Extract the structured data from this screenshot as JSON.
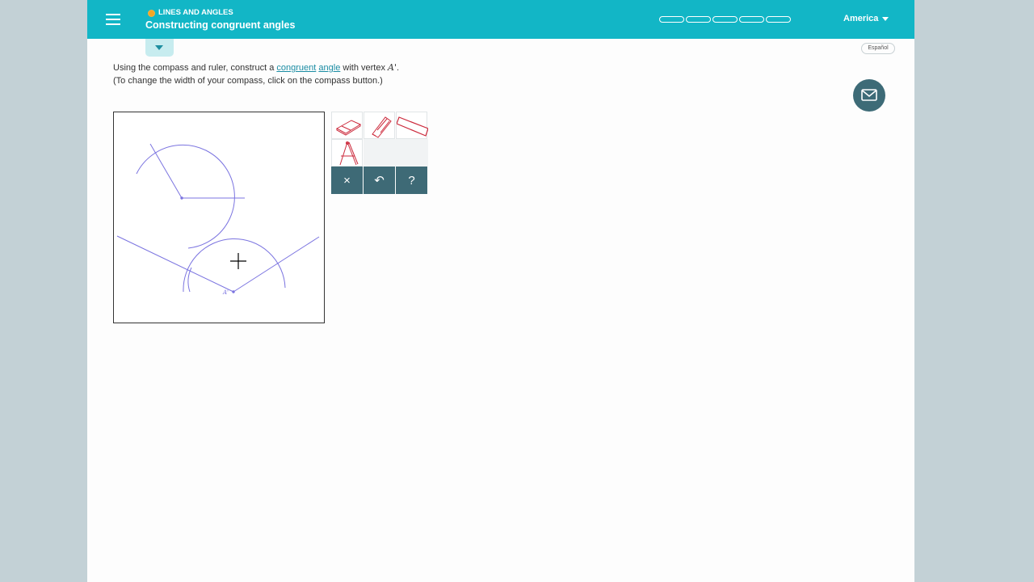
{
  "header": {
    "topic_label": "LINES AND ANGLES",
    "title": "Constructing congruent angles",
    "region": "America",
    "progress_segments": 5,
    "progress_filled": 0
  },
  "language_button": "Español",
  "instruction": {
    "line1_prefix": "Using the compass and ruler, construct a ",
    "link1": "congruent",
    "link2": "angle",
    "line1_suffix": " with vertex ",
    "vertex_label": "A'",
    "line1_end": ".",
    "line2": "(To change the width of your compass, click on the compass button.)"
  },
  "canvas": {
    "point_label": "A'"
  },
  "toolbar": {
    "tools": [
      "eraser-icon",
      "pencil-icon",
      "ruler-icon",
      "compass-icon"
    ],
    "controls": {
      "clear": "×",
      "undo": "↶",
      "help": "?"
    }
  },
  "colors": {
    "header": "#12b6c6",
    "accent_link": "#1a8ca3",
    "construction": "#7b74e0",
    "tool_icon": "#cc2a3c",
    "control_bg": "#3e6a76"
  }
}
